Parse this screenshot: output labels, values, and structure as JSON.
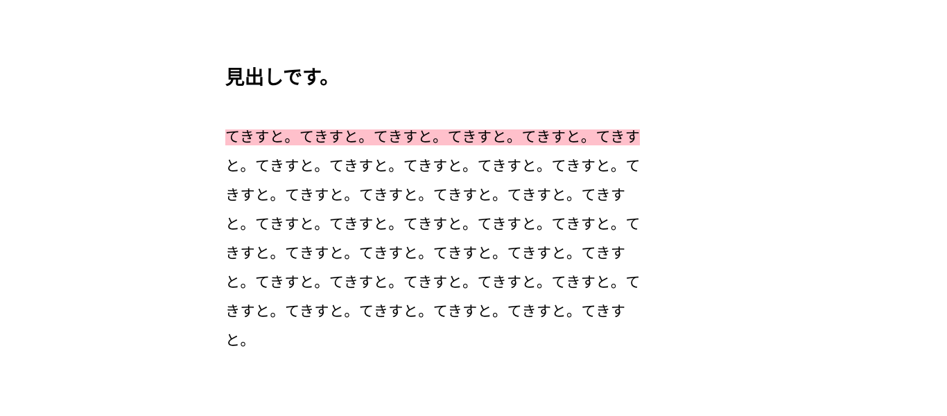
{
  "heading": "見出しです。",
  "paragraph": "てきすと。てきすと。てきすと。てきすと。てきすと。てきすと。てきすと。てきすと。てきすと。てきすと。てきすと。てきすと。てきすと。てきすと。てきすと。てきすと。てきすと。てきすと。てきすと。てきすと。てきすと。てきすと。てきすと。てきすと。てきすと。てきすと。てきすと。てきすと。てきすと。てきすと。てきすと。てきすと。てきすと。てきすと。てきすと。てきすと。てきすと。てきすと。てきすと。",
  "highlight_color": "#FFC0CB"
}
